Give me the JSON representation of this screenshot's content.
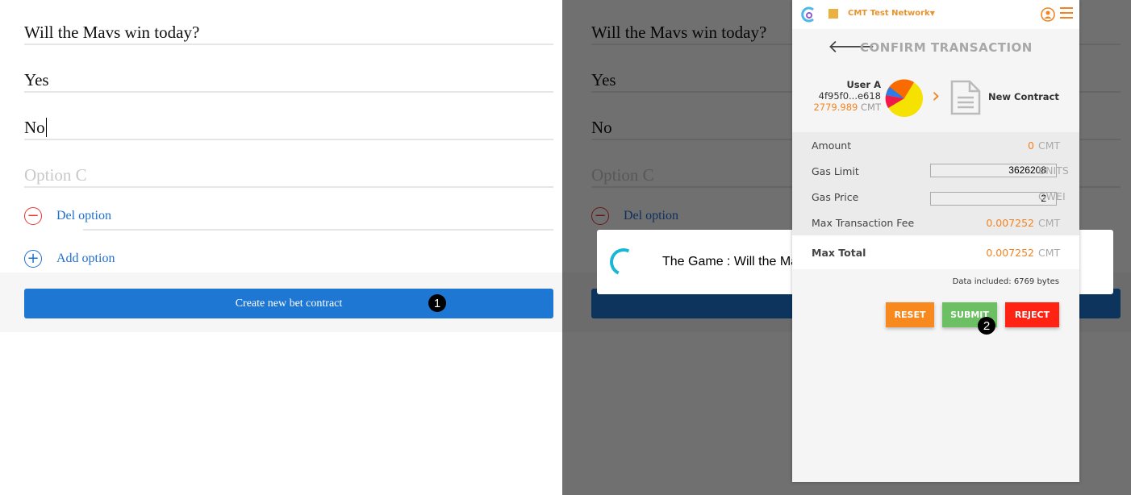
{
  "form": {
    "question": "Will the Mavs win today?",
    "options": [
      "Yes",
      "No"
    ],
    "option_placeholder": "Option C",
    "del_option": "Del option",
    "add_option": "Add option",
    "create_button": "Create new bet contract",
    "badge_1": "1"
  },
  "modal": {
    "text": "The Game : Will the Ma"
  },
  "wallet": {
    "network": "CMT Test Network",
    "title": "CONFIRM TRANSACTION",
    "from_name": "User A",
    "from_address": "4f95f0...e618",
    "balance": "2779.989",
    "currency": "CMT",
    "to": "New Contract",
    "amount_label": "Amount",
    "amount_value": "0",
    "gas_limit_label": "Gas Limit",
    "gas_limit_value": "3626208",
    "gas_limit_unit": "UNITS",
    "gas_price_label": "Gas Price",
    "gas_price_value": "2",
    "gas_price_unit": "GWEI",
    "fee_label": "Max Transaction Fee",
    "fee_value": "0.007252",
    "total_label": "Max Total",
    "total_value": "0.007252",
    "data_included": "Data included: 6769 bytes",
    "reset": "RESET",
    "submit": "SUBMIT",
    "reject": "REJECT",
    "badge_2": "2",
    "colors": {
      "accent": "#f58220",
      "reset": "#f7891f",
      "submit": "#6cc063",
      "reject": "#ff2313"
    }
  }
}
